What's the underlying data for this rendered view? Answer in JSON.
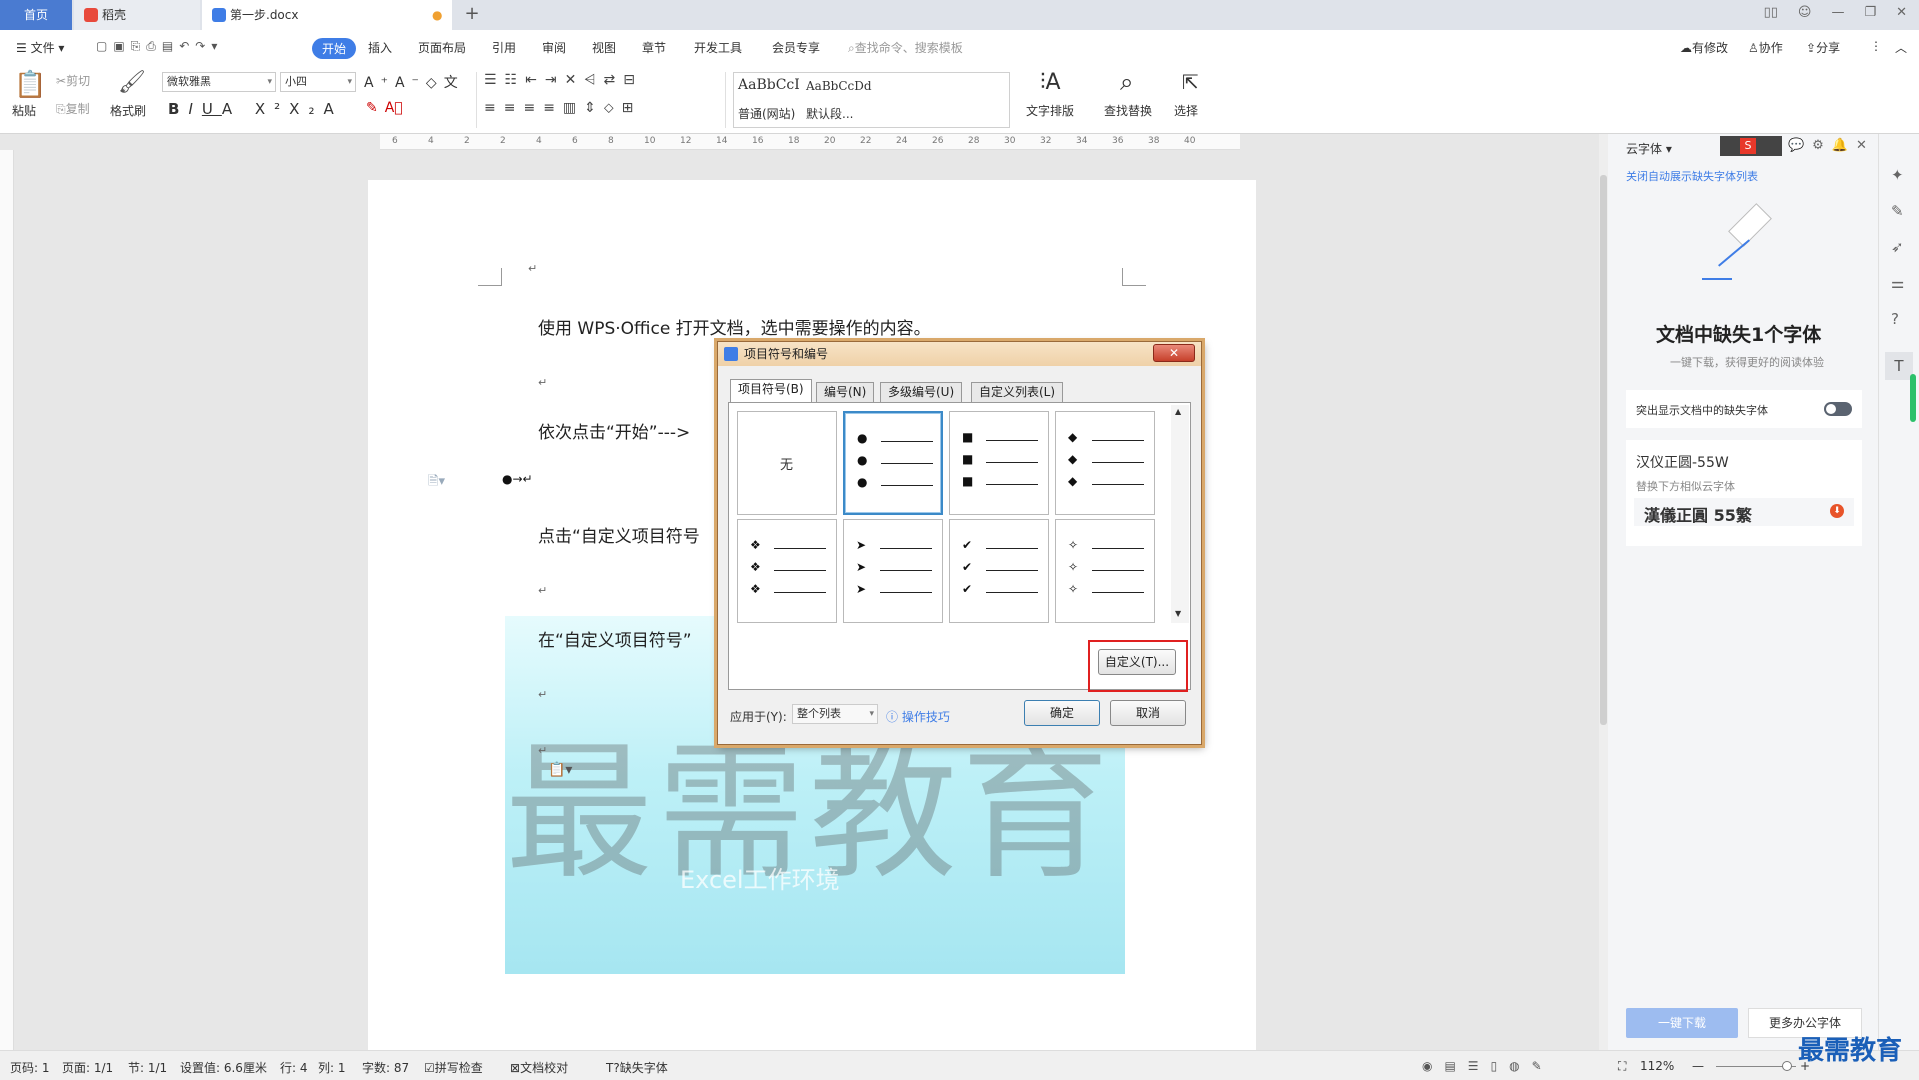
{
  "tabs": {
    "home": "首页",
    "shell": "稻壳",
    "doc": "第一步.docx",
    "new": "+"
  },
  "menu": {
    "file": "文件",
    "items": [
      "开始",
      "插入",
      "页面布局",
      "引用",
      "审阅",
      "视图",
      "章节",
      "开发工具",
      "会员专享"
    ],
    "search_placeholder": "查找命令、搜索模板",
    "modify": "有修改",
    "collab": "协作",
    "share": "分享"
  },
  "ribbon": {
    "paste": "粘贴",
    "cut": "剪切",
    "copy": "复制",
    "format_painter": "格式刷",
    "font_name": "微软雅黑",
    "font_size": "小四",
    "style1_preview": "AaBbCcI",
    "style1": "普通(网站)",
    "style2_preview": "AaBbCcDd",
    "style2": "默认段...",
    "text_layout": "文字排版",
    "find_replace": "查找替换",
    "select": "选择"
  },
  "ruler": {
    "ticks": [
      "6",
      "4",
      "2",
      "2",
      "4",
      "6",
      "8",
      "10",
      "12",
      "14",
      "16",
      "18",
      "20",
      "22",
      "24",
      "26",
      "28",
      "30",
      "32",
      "34",
      "36",
      "38",
      "40"
    ]
  },
  "doc": {
    "line1": "使用 WPS·Office 打开文档，选中需要操作的内容。",
    "line2": "依次点击“开始”--->",
    "line3": "点击“自定义项目符号",
    "line4": "在“自定义项目符号”",
    "watermark": "最需教育",
    "image_caption": "Excel工作环境"
  },
  "dialog": {
    "title": "项目符号和编号",
    "tabs": [
      "项目符号(B)",
      "编号(N)",
      "多级编号(U)",
      "自定义列表(L)"
    ],
    "none": "无",
    "symbols": [
      "●",
      "■",
      "◆",
      "❖",
      "➤",
      "✔",
      "✧"
    ],
    "customize": "自定义(T)...",
    "apply_label": "应用于(Y):",
    "apply_value": "整个列表",
    "tips": "操作技巧",
    "ok": "确定",
    "cancel": "取消"
  },
  "panel": {
    "header": "云字体",
    "close_link": "关闭自动展示缺失字体列表",
    "title": "文档中缺失1个字体",
    "subtitle": "一键下载，获得更好的阅读体验",
    "toggle_label": "突出显示文档中的缺失字体",
    "font_name": "汉仪正圆-55W",
    "replace_hint": "替换下方相似云字体",
    "replace_font": "漢儀正圓 55繁",
    "download": "一键下载",
    "more": "更多办公字体"
  },
  "status": {
    "page": "页码: 1",
    "pages": "页面: 1/1",
    "section": "节: 1/1",
    "setting": "设置值: 6.6厘米",
    "row": "行: 4",
    "col": "列: 1",
    "words": "字数: 87",
    "spell": "拼写检查",
    "proof": "文档校对",
    "missing_font": "缺失字体",
    "zoom": "112%"
  },
  "brand": "最需教育",
  "colors": {
    "accent": "#3f7de6",
    "dialog_border": "#d9a86a",
    "highlight": "#e02020"
  }
}
